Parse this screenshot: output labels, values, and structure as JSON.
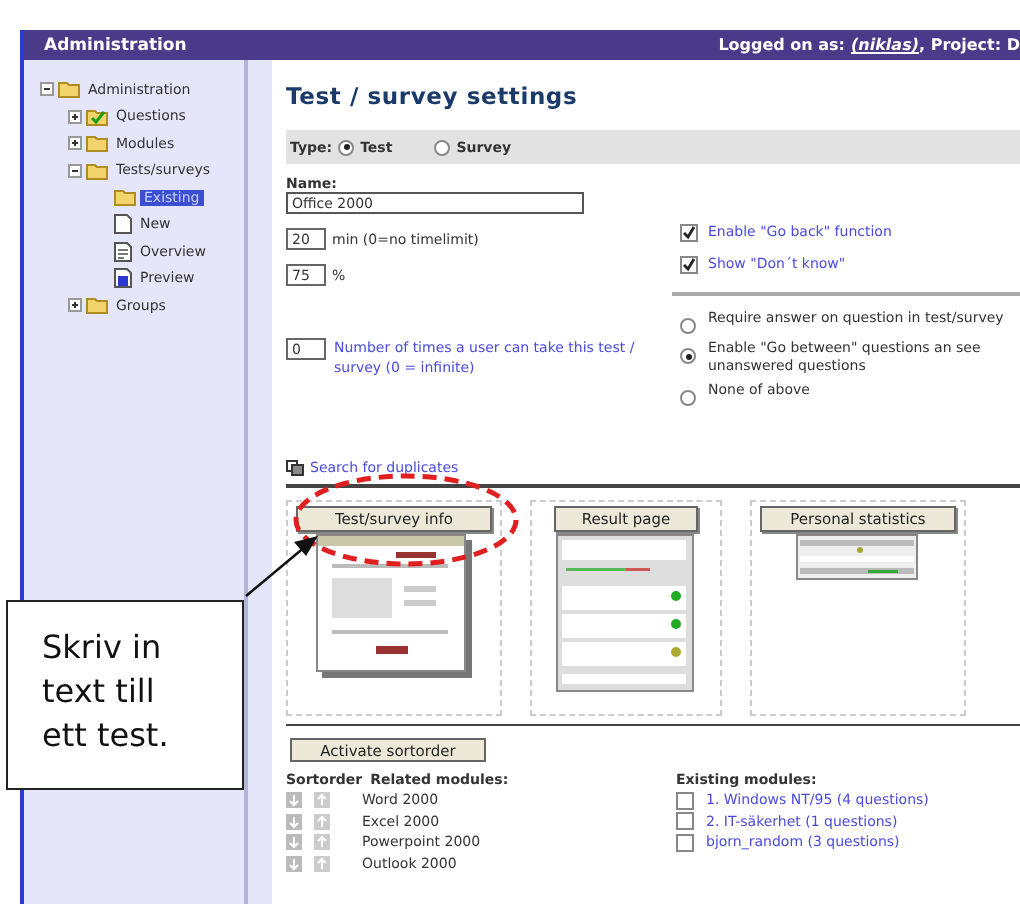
{
  "header": {
    "title": "Administration",
    "login_label": "Logged on as:",
    "user": "(niklas)",
    "project_label": ", Project: D"
  },
  "sidebar": {
    "tree": [
      {
        "label": "Administration",
        "kind": "folder",
        "expanded": true,
        "selected": false,
        "children": [
          {
            "label": "Questions",
            "kind": "checkfolder",
            "expanded": false,
            "selected": false
          },
          {
            "label": "Modules",
            "kind": "folder",
            "expanded": false,
            "selected": false
          },
          {
            "label": "Tests/surveys",
            "kind": "folder",
            "expanded": true,
            "selected": false,
            "children": [
              {
                "label": "Existing",
                "kind": "folder",
                "selected": true
              },
              {
                "label": "New",
                "kind": "page",
                "selected": false
              },
              {
                "label": "Overview",
                "kind": "doc",
                "selected": false
              },
              {
                "label": "Preview",
                "kind": "preview",
                "selected": false
              }
            ]
          },
          {
            "label": "Groups",
            "kind": "folder",
            "expanded": false,
            "selected": false
          }
        ]
      }
    ]
  },
  "settings": {
    "title": "Test / survey settings",
    "type_label": "Type:",
    "types": [
      {
        "label": "Test",
        "selected": true
      },
      {
        "label": "Survey",
        "selected": false
      }
    ],
    "name_label": "Name:",
    "name_value": "Office 2000",
    "time_value": "20",
    "time_unit": "min (0=no timelimit)",
    "pass_value": "75",
    "pass_unit": "%",
    "attempts_value": "0",
    "attempts_label": "Number of times a user can take this test / survey (0 = infinite)",
    "checkboxes": [
      {
        "label": "Enable \"Go back\" function",
        "checked": true
      },
      {
        "label": "Show \"Don´t know\"",
        "checked": true
      }
    ],
    "radios": [
      {
        "label": "Require answer on question in test/survey",
        "selected": false
      },
      {
        "label": "Enable \"Go between\" questions an see unanswered questions",
        "selected": true
      },
      {
        "label": "None of above",
        "selected": false
      }
    ],
    "search_link": "Search for duplicates"
  },
  "previews": [
    {
      "label": "Test/survey info",
      "kind": "info"
    },
    {
      "label": "Result page",
      "kind": "result"
    },
    {
      "label": "Personal statistics",
      "kind": "stats"
    }
  ],
  "modules": {
    "activate_button": "Activate sortorder",
    "sort_header": "Sortorder",
    "related_header": "Related modules:",
    "related": [
      "Word 2000",
      "Excel 2000",
      "Powerpoint 2000",
      "Outlook 2000"
    ],
    "existing_header": "Existing modules:",
    "existing": [
      {
        "label": "1. Windows NT/95 (4 questions)",
        "checked": false
      },
      {
        "label": "2. IT-säkerhet (1 questions)",
        "checked": false
      },
      {
        "label": "bjorn_random (3 questions)",
        "checked": false
      }
    ]
  },
  "callout": {
    "text": "Skriv in text till ett test."
  }
}
